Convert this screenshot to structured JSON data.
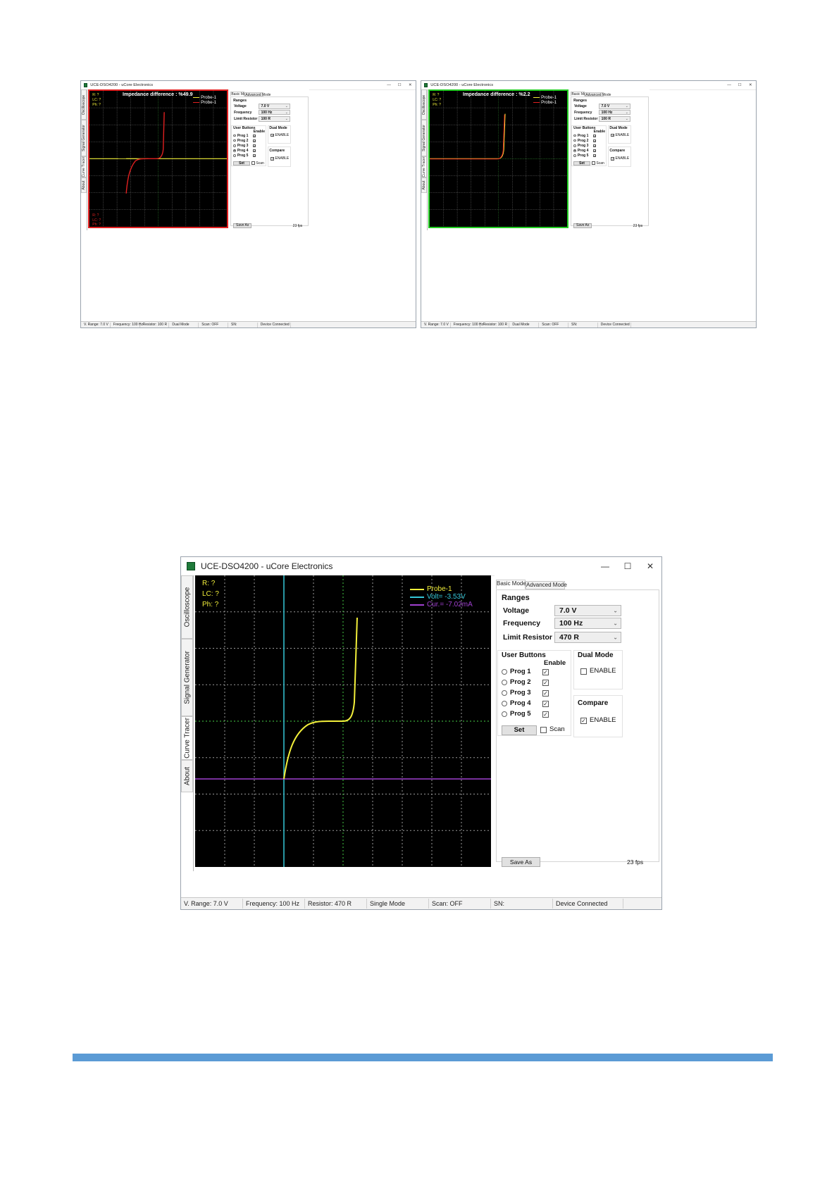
{
  "window_title": "UCE-DSO4200 - uCore Electronics",
  "window_controls": {
    "minimize": "—",
    "maximize": "☐",
    "close": "✕"
  },
  "side_tabs": [
    "Oscilloscope",
    "Signal Generator",
    "Curve Tracer",
    "About"
  ],
  "panel": {
    "tab_basic": "Basic Mode",
    "tab_advanced": "Advanced Mode",
    "ranges_title": "Ranges",
    "voltage_label": "Voltage",
    "frequency_label": "Frequency",
    "limit_label": "Limit Resistor",
    "user_buttons_title": "User Buttons",
    "enable_label": "Enable",
    "progs": [
      "Prog 1",
      "Prog 2",
      "Prog 3",
      "Prog 4",
      "Prog 5"
    ],
    "set_label": "Set",
    "scan_label": "Scan",
    "dual_mode_title": "Dual Mode",
    "compare_title": "Compare",
    "enable_cb_label": "ENABLE",
    "save_label": "Save As",
    "fps": "23 fps"
  },
  "screens": [
    {
      "voltage": "7.0 V",
      "frequency": "100 Hz",
      "limit": "100 R",
      "selected_prog": 4,
      "dual_enabled": true,
      "compare_enabled": true,
      "scope_border_color": "#e02020",
      "impedance_title": "Impedance difference : %49.9",
      "legend": [
        "Probe-1",
        "Probe-1"
      ],
      "top_readouts": [
        "R: ?",
        "LC: ?",
        "Ph: ?"
      ],
      "bottom_readouts": [
        "R: ?",
        "LC: ?",
        "Ph: ?"
      ],
      "status": [
        "V. Range: 7.0 V",
        "Frequency: 100 Hz",
        "Resistor: 100 R",
        "Dual Mode",
        "Scan: OFF",
        "SN:",
        "Device Connected"
      ]
    },
    {
      "voltage": "7.0 V",
      "frequency": "100 Hz",
      "limit": "100 R",
      "selected_prog": 4,
      "dual_enabled": true,
      "compare_enabled": true,
      "scope_border_color": "#22cc22",
      "impedance_title": "Impedance difference : %2.2",
      "legend": [
        "Probe-1",
        "Probe-1"
      ],
      "top_readouts": [
        "R: ?",
        "LC: ?",
        "Ph: ?"
      ],
      "status": [
        "V. Range: 7.0 V",
        "Frequency: 100 Hz",
        "Resistor: 100 R",
        "Dual Mode",
        "Scan: OFF",
        "SN:",
        "Device Connected"
      ]
    },
    {
      "voltage": "7.0 V",
      "frequency": "100 Hz",
      "limit": "470 R",
      "selected_prog": 0,
      "dual_enabled": false,
      "compare_enabled": true,
      "top_readouts": [
        "R: ?",
        "LC: ?",
        "Ph: ?"
      ],
      "legend": [
        "Probe-1",
        "Volt= -3.53V",
        "Cur.= -7.02mA"
      ],
      "status": [
        "V. Range: 7.0 V",
        "Frequency: 100 Hz",
        "Resistor: 470 R",
        "Single Mode",
        "Scan: OFF",
        "SN:",
        "Device Connected"
      ]
    }
  ],
  "colors": {
    "probe_yellow": "#f2ef3a",
    "probe_red": "#e02020",
    "volt_cursor": "#35c8d8",
    "cur_cursor": "#a040d0",
    "grid_dots": "#9a9a9a",
    "axis_green": "#3aa83a",
    "footer_bar": "#5b9bd5"
  }
}
